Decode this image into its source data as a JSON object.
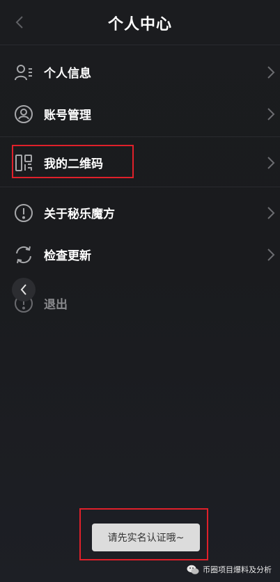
{
  "header": {
    "title": "个人中心"
  },
  "menu": [
    {
      "label": "个人信息",
      "icon": "user-info-icon"
    },
    {
      "label": "账号管理",
      "icon": "account-icon"
    },
    {
      "label": "我的二维码",
      "icon": "qr-code-icon"
    },
    {
      "label": "关于秘乐魔方",
      "icon": "about-icon"
    },
    {
      "label": "检查更新",
      "icon": "refresh-icon"
    },
    {
      "label": "退出",
      "icon": "logout-icon"
    }
  ],
  "toast": {
    "text": "请先实名认证哦~"
  },
  "watermark": {
    "text": "币圈项目爆料及分析"
  },
  "colors": {
    "background": "#1b1c1f",
    "highlight": "#e0202a",
    "toast_bg": "#dcdcdc"
  }
}
